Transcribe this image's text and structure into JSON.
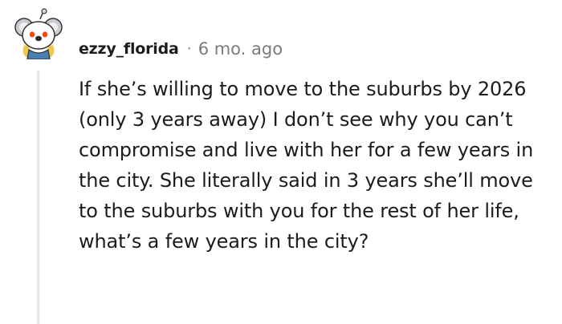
{
  "comment": {
    "author": "ezzy_florida",
    "separator": "·",
    "time_ago": "6 mo. ago",
    "avatar_icon": "snoo-koala-avatar-icon",
    "body": "If she’s willing to move to the suburbs by 2026 (only 3 years away) I don’t see why you can’t compromise and live with her for a few years in the city. She literally said in 3 years she’ll move to the suburbs with you for the rest of her life, what’s a few years in the city?"
  }
}
